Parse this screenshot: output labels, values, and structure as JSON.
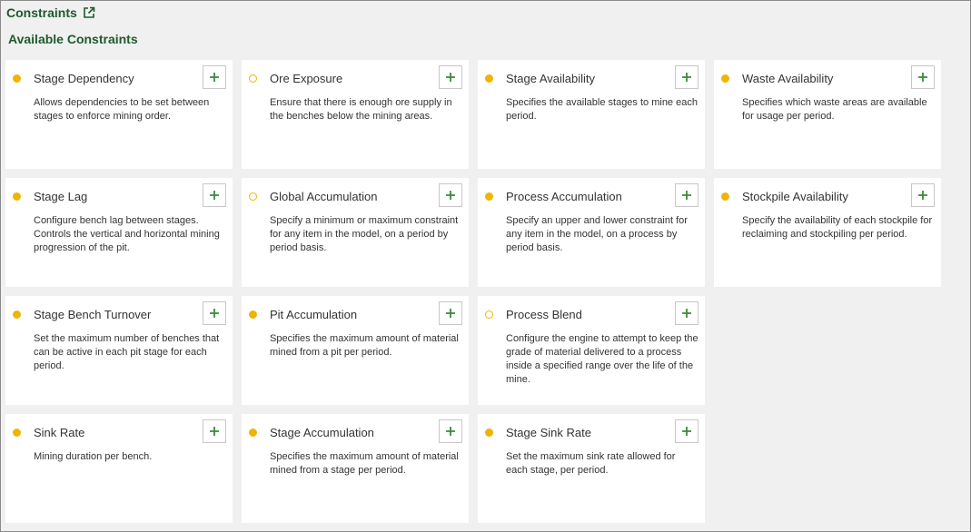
{
  "header": {
    "title": "Constraints",
    "subtitle": "Available Constraints"
  },
  "colors": {
    "accent_green": "#1f5a2c",
    "plus_green": "#3a8a3a",
    "status_yellow": "#f0b400"
  },
  "cards": [
    {
      "title": "Stage Dependency",
      "desc": "Allows dependencies to be set between stages to enforce mining order.",
      "status": "filled"
    },
    {
      "title": "Ore Exposure",
      "desc": "Ensure that there is enough ore supply in the benches below the mining areas.",
      "status": "hollow"
    },
    {
      "title": "Stage Availability",
      "desc": "Specifies the available stages to mine each period.",
      "status": "filled"
    },
    {
      "title": "Waste Availability",
      "desc": "Specifies which waste areas are available for usage per period.",
      "status": "filled"
    },
    {
      "title": "Stage Lag",
      "desc": "Configure bench lag between stages. Controls the vertical and horizontal mining progression of the pit.",
      "status": "filled"
    },
    {
      "title": "Global Accumulation",
      "desc": "Specify a minimum or maximum constraint for any item in the model, on a period by period basis.",
      "status": "hollow"
    },
    {
      "title": "Process Accumulation",
      "desc": "Specify an upper and lower constraint for any item in the model, on a process by period basis.",
      "status": "filled"
    },
    {
      "title": "Stockpile Availability",
      "desc": "Specify the availability of each stockpile for reclaiming and stockpiling per period.",
      "status": "filled"
    },
    {
      "title": "Stage Bench Turnover",
      "desc": "Set the maximum number of benches that can be active in each pit stage for each period.",
      "status": "filled"
    },
    {
      "title": "Pit Accumulation",
      "desc": "Specifies the maximum amount of material mined from a pit per period.",
      "status": "filled"
    },
    {
      "title": "Process Blend",
      "desc": "Configure the engine to attempt to keep the grade of material delivered to a process inside a specified range over the life of the mine.",
      "status": "hollow"
    },
    null,
    {
      "title": "Sink Rate",
      "desc": "Mining duration per bench.",
      "status": "filled"
    },
    {
      "title": "Stage Accumulation",
      "desc": "Specifies the maximum amount of material mined from a stage per period.",
      "status": "filled"
    },
    {
      "title": "Stage Sink Rate",
      "desc": "Set the maximum sink rate allowed for each stage, per period.",
      "status": "filled"
    }
  ]
}
